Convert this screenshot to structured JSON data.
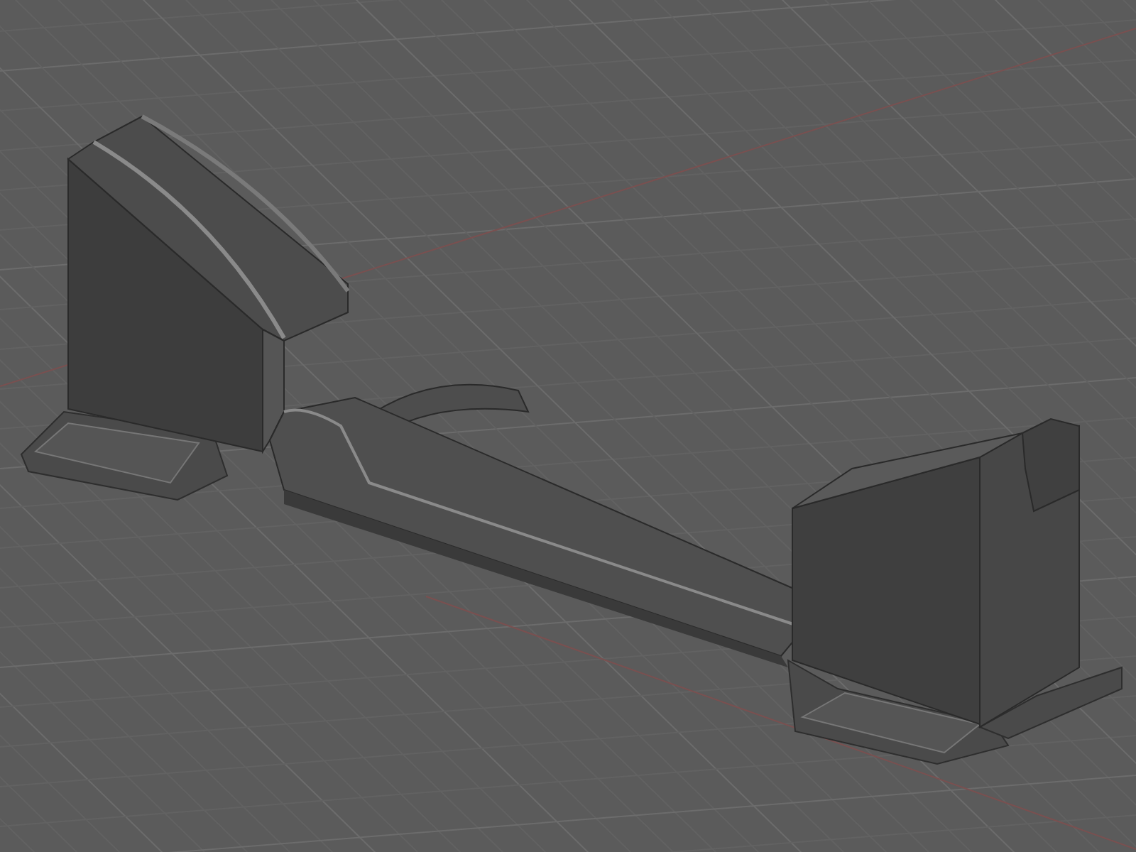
{
  "viewport": {
    "grid": true,
    "axis_lines": true
  }
}
